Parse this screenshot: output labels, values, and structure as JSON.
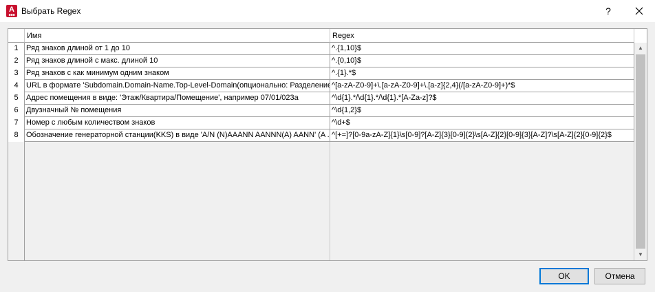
{
  "window": {
    "title": "Выбрать Regex",
    "help_label": "?",
    "app_icon_letter": "A"
  },
  "grid": {
    "header_name": "Имя",
    "header_regex": "Regex",
    "rows": [
      {
        "num": "1",
        "name": "Ряд знаков длиной от 1 до 10",
        "regex": "^.{1,10}$"
      },
      {
        "num": "2",
        "name": "Ряд знаков длиной с макс. длиной 10",
        "regex": "^.{0,10}$"
      },
      {
        "num": "3",
        "name": "Ряд знаков с как минимум одним знаком",
        "regex": "^.{1}.*$"
      },
      {
        "num": "4",
        "name": "URL в формате 'Subdomain.Domain-Name.Top-Level-Domain(опционально: Разделение...",
        "regex": "^[a-zA-Z0-9]+\\.[a-zA-Z0-9]+\\.[a-z]{2,4}(/[a-zA-Z0-9]+)*$"
      },
      {
        "num": "5",
        "name": "Адрес помещения в виде: 'Этаж/Квартира/Помещение', например 07/01/023a",
        "regex": "^\\d{1}.*/\\d{1}.*/\\d{1}.*[A-Za-z]?$"
      },
      {
        "num": "6",
        "name": "Двузначный № помещения",
        "regex": "^\\d{1,2}$"
      },
      {
        "num": "7",
        "name": "Номер с любым количеством знаков",
        "regex": "^\\d+$"
      },
      {
        "num": "8",
        "name": "Обозначение генераторной станции(KKS) в виде 'A/N (N)AAANN AANNN(A) AANN' (A ...",
        "regex": "^[+=]?[0-9a-zA-Z]{1}\\s[0-9]?[A-Z]{3}[0-9]{2}\\s[A-Z]{2}[0-9]{3}[A-Z]?\\s[A-Z]{2}[0-9]{2}$"
      }
    ]
  },
  "buttons": {
    "ok": "OK",
    "cancel": "Отмена"
  }
}
